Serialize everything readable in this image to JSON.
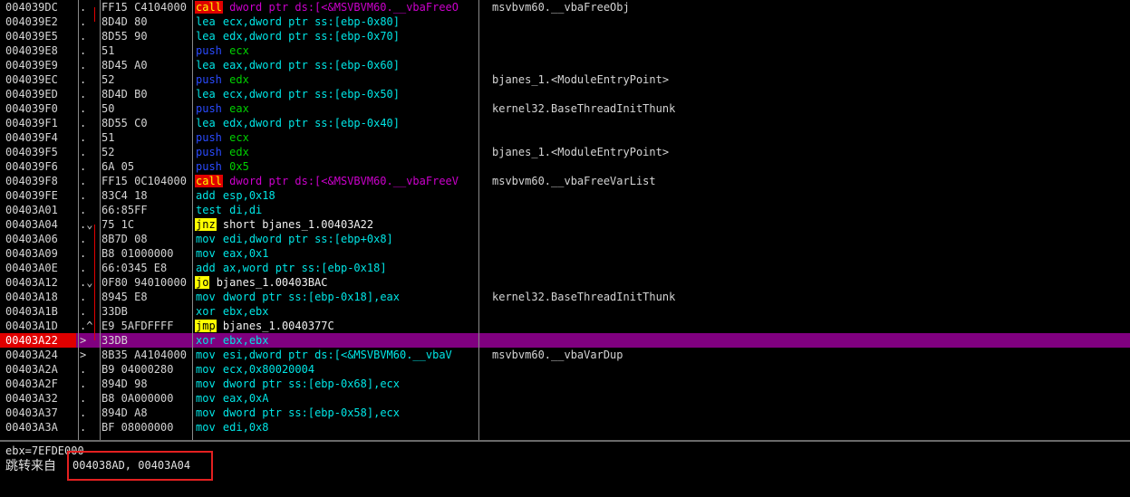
{
  "disassembly": {
    "rows": [
      {
        "addr": "004039DC",
        "mark": ".",
        "hex": "FF15 C4104000",
        "mn": "call",
        "mk": "call",
        "op": "dword ptr ds:[<&MSVBVM60.__vbaFreeO",
        "cmt": "msvbvm60.__vbaFreeObj"
      },
      {
        "addr": "004039E2",
        "mark": ".",
        "hex": "8D4D 80",
        "mn": "lea",
        "mk": "lea",
        "op": "ecx,dword ptr ss:[ebp-0x80]",
        "cmt": ""
      },
      {
        "addr": "004039E5",
        "mark": ".",
        "hex": "8D55 90",
        "mn": "lea",
        "mk": "lea",
        "op": "edx,dword ptr ss:[ebp-0x70]",
        "cmt": ""
      },
      {
        "addr": "004039E8",
        "mark": ".",
        "hex": "51",
        "mn": "push",
        "mk": "push",
        "op": "ecx",
        "cmt": ""
      },
      {
        "addr": "004039E9",
        "mark": ".",
        "hex": "8D45 A0",
        "mn": "lea",
        "mk": "lea",
        "op": "eax,dword ptr ss:[ebp-0x60]",
        "cmt": ""
      },
      {
        "addr": "004039EC",
        "mark": ".",
        "hex": "52",
        "mn": "push",
        "mk": "push",
        "op": "edx",
        "cmt": "bjanes_1.<ModuleEntryPoint>"
      },
      {
        "addr": "004039ED",
        "mark": ".",
        "hex": "8D4D B0",
        "mn": "lea",
        "mk": "lea",
        "op": "ecx,dword ptr ss:[ebp-0x50]",
        "cmt": ""
      },
      {
        "addr": "004039F0",
        "mark": ".",
        "hex": "50",
        "mn": "push",
        "mk": "push",
        "op": "eax",
        "cmt": "kernel32.BaseThreadInitThunk"
      },
      {
        "addr": "004039F1",
        "mark": ".",
        "hex": "8D55 C0",
        "mn": "lea",
        "mk": "lea",
        "op": "edx,dword ptr ss:[ebp-0x40]",
        "cmt": ""
      },
      {
        "addr": "004039F4",
        "mark": ".",
        "hex": "51",
        "mn": "push",
        "mk": "push",
        "op": "ecx",
        "cmt": ""
      },
      {
        "addr": "004039F5",
        "mark": ".",
        "hex": "52",
        "mn": "push",
        "mk": "push",
        "op": "edx",
        "cmt": "bjanes_1.<ModuleEntryPoint>"
      },
      {
        "addr": "004039F6",
        "mark": ".",
        "hex": "6A 05",
        "mn": "push",
        "mk": "push",
        "op": "0x5",
        "cmt": ""
      },
      {
        "addr": "004039F8",
        "mark": ".",
        "hex": "FF15 0C104000",
        "mn": "call",
        "mk": "call",
        "op": "dword ptr ds:[<&MSVBVM60.__vbaFreeV",
        "cmt": "msvbvm60.__vbaFreeVarList"
      },
      {
        "addr": "004039FE",
        "mark": ".",
        "hex": "83C4 18",
        "mn": "add",
        "mk": "add",
        "op": "esp,0x18",
        "cmt": ""
      },
      {
        "addr": "00403A01",
        "mark": ".",
        "hex": "66:85FF",
        "mn": "test",
        "mk": "test",
        "op": "di,di",
        "cmt": ""
      },
      {
        "addr": "00403A04",
        "mark": ".⌄",
        "hex": "75 1C",
        "mn": "jnz",
        "mk": "jcc",
        "op": "short bjanes_1.00403A22",
        "cmt": ""
      },
      {
        "addr": "00403A06",
        "mark": ".",
        "hex": "8B7D 08",
        "mn": "mov",
        "mk": "mov",
        "op": "edi,dword ptr ss:[ebp+0x8]",
        "cmt": ""
      },
      {
        "addr": "00403A09",
        "mark": ".",
        "hex": "B8 01000000",
        "mn": "mov",
        "mk": "mov",
        "op": "eax,0x1",
        "cmt": ""
      },
      {
        "addr": "00403A0E",
        "mark": ".",
        "hex": "66:0345 E8",
        "mn": "add",
        "mk": "add",
        "op": "ax,word ptr ss:[ebp-0x18]",
        "cmt": ""
      },
      {
        "addr": "00403A12",
        "mark": ".⌄",
        "hex": "0F80 94010000",
        "mn": "jo",
        "mk": "jcc",
        "op": "bjanes_1.00403BAC",
        "cmt": ""
      },
      {
        "addr": "00403A18",
        "mark": ".",
        "hex": "8945 E8",
        "mn": "mov",
        "mk": "mov",
        "op": "dword ptr ss:[ebp-0x18],eax",
        "cmt": "kernel32.BaseThreadInitThunk"
      },
      {
        "addr": "00403A1B",
        "mark": ".",
        "hex": "33DB",
        "mn": "xor",
        "mk": "xor",
        "op": "ebx,ebx",
        "cmt": ""
      },
      {
        "addr": "00403A1D",
        "mark": ".^",
        "hex": "E9 5AFDFFFF",
        "mn": "jmp",
        "mk": "jcc",
        "op": "bjanes_1.0040377C",
        "cmt": ""
      },
      {
        "addr": "00403A22",
        "mark": ">",
        "hex": "33DB",
        "mn": "xor",
        "mk": "xor",
        "op": "ebx,ebx",
        "cmt": "",
        "selected": true
      },
      {
        "addr": "00403A24",
        "mark": ">",
        "hex": "8B35 A4104000",
        "mn": "mov",
        "mk": "mov",
        "op": "esi,dword ptr ds:[<&MSVBVM60.__vbaV",
        "cmt": "msvbvm60.__vbaVarDup"
      },
      {
        "addr": "00403A2A",
        "mark": ".",
        "hex": "B9 04000280",
        "mn": "mov",
        "mk": "mov",
        "op": "ecx,0x80020004",
        "cmt": ""
      },
      {
        "addr": "00403A2F",
        "mark": ".",
        "hex": "894D 98",
        "mn": "mov",
        "mk": "mov",
        "op": "dword ptr ss:[ebp-0x68],ecx",
        "cmt": ""
      },
      {
        "addr": "00403A32",
        "mark": ".",
        "hex": "B8 0A000000",
        "mn": "mov",
        "mk": "mov",
        "op": "eax,0xA",
        "cmt": ""
      },
      {
        "addr": "00403A37",
        "mark": ".",
        "hex": "894D A8",
        "mn": "mov",
        "mk": "mov",
        "op": "dword ptr ss:[ebp-0x58],ecx",
        "cmt": ""
      },
      {
        "addr": "00403A3A",
        "mark": ".",
        "hex": "BF 08000000",
        "mn": "mov",
        "mk": "mov",
        "op": "edi,0x8",
        "cmt": ""
      }
    ]
  },
  "info_pane": {
    "register_line": "ebx=7EFDE000",
    "jump_from_label": "跳转来自",
    "jump_from_value": "004038AD, 00403A04"
  },
  "colors": {
    "background": "#000000",
    "selected_row": "#800080",
    "selected_address": "#e00000",
    "call_highlight": "#e00000",
    "jump_highlight": "#ffff00",
    "annotation_box": "#e32020"
  }
}
